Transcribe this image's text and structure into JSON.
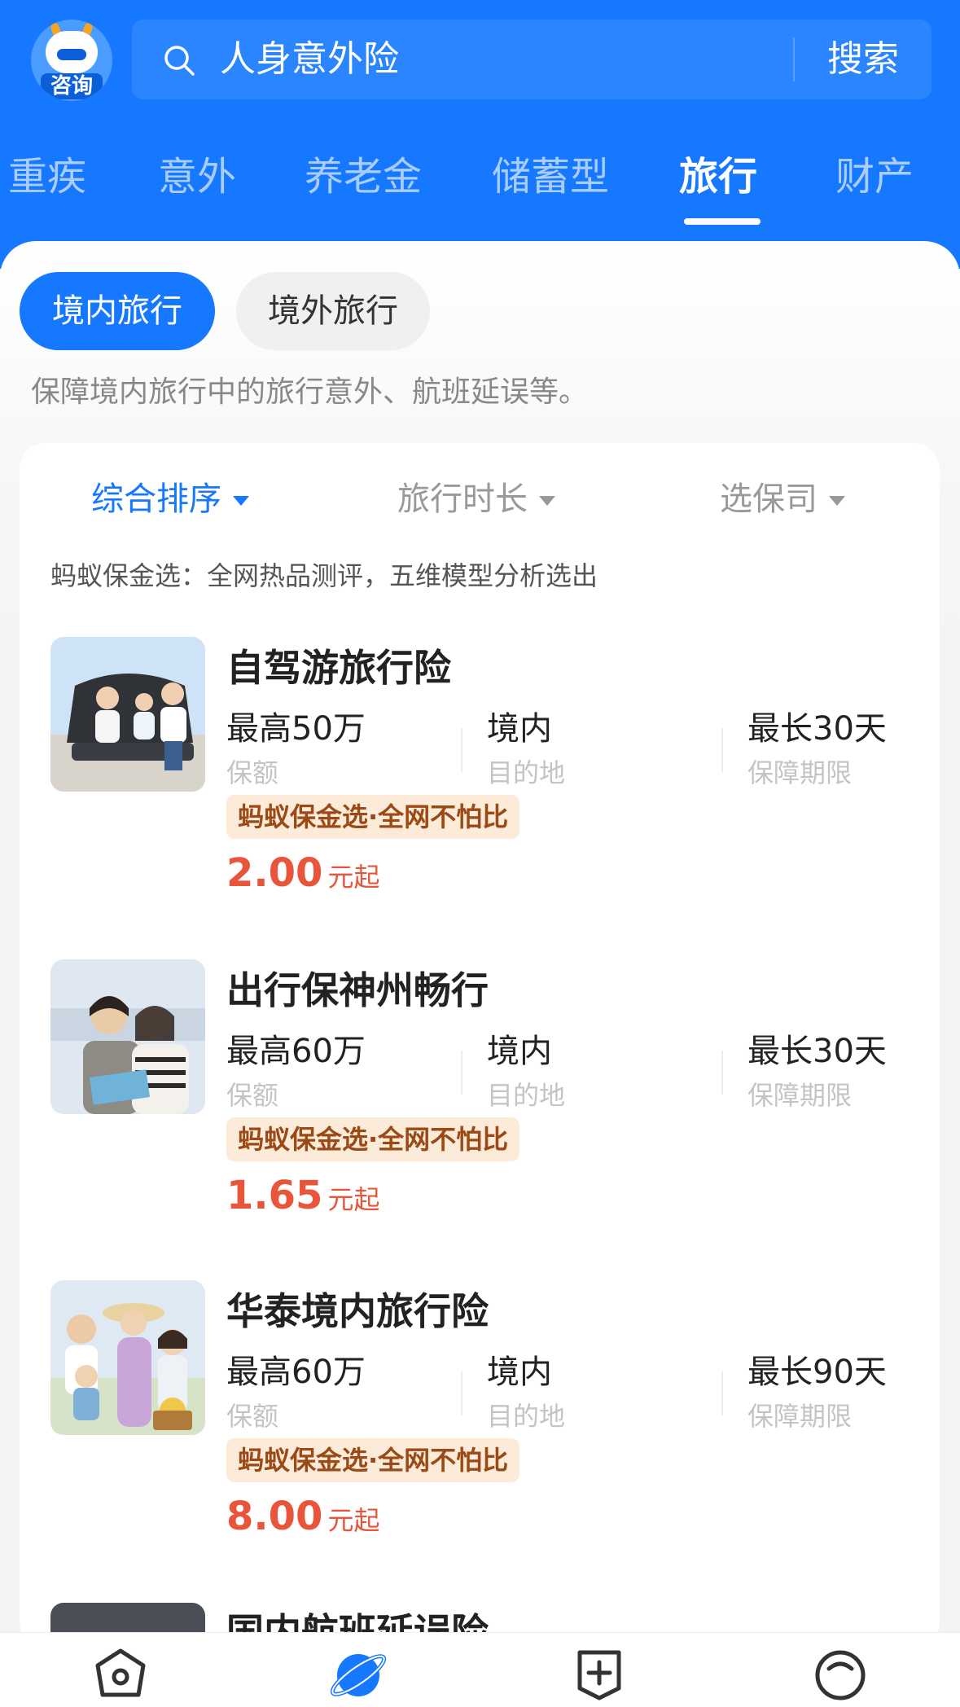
{
  "header": {
    "consult_label": "咨询",
    "search_text": "人身意外险",
    "search_button": "搜索"
  },
  "tabs": [
    {
      "label": "重疾",
      "active": false
    },
    {
      "label": "意外",
      "active": false
    },
    {
      "label": "养老金",
      "active": false
    },
    {
      "label": "储蓄型",
      "active": false
    },
    {
      "label": "旅行",
      "active": true
    },
    {
      "label": "财产",
      "active": false
    }
  ],
  "subtabs": [
    {
      "label": "境内旅行",
      "active": true
    },
    {
      "label": "境外旅行",
      "active": false
    }
  ],
  "description": "保障境内旅行中的旅行意外、航班延误等。",
  "filters": [
    {
      "label": "综合排序",
      "active": true
    },
    {
      "label": "旅行时长",
      "active": false
    },
    {
      "label": "选保司",
      "active": false
    }
  ],
  "tagline": "蚂蚁保金选：全网热品测评，五维模型分析选出",
  "products": [
    {
      "name": "自驾游旅行险",
      "coverage_value": "最高50万",
      "coverage_label": "保额",
      "destination_value": "境内",
      "destination_label": "目的地",
      "period_value": "最长30天",
      "period_label": "保障期限",
      "badge": "蚂蚁保金选·全网不怕比",
      "price": "2.00",
      "price_unit": "元起"
    },
    {
      "name": "出行保神州畅行",
      "coverage_value": "最高60万",
      "coverage_label": "保额",
      "destination_value": "境内",
      "destination_label": "目的地",
      "period_value": "最长30天",
      "period_label": "保障期限",
      "badge": "蚂蚁保金选·全网不怕比",
      "price": "1.65",
      "price_unit": "元起"
    },
    {
      "name": "华泰境内旅行险",
      "coverage_value": "最高60万",
      "coverage_label": "保额",
      "destination_value": "境内",
      "destination_label": "目的地",
      "period_value": "最长90天",
      "period_label": "保障期限",
      "badge": "蚂蚁保金选·全网不怕比",
      "price": "8.00",
      "price_unit": "元起"
    }
  ],
  "partial_product_name": "国内航班延误险",
  "colors": {
    "brand_blue": "#1677ff",
    "price_red": "#e8553a",
    "badge_bg": "#fdebd9"
  },
  "bottom_nav": [
    {
      "icon": "home-icon",
      "active": false
    },
    {
      "icon": "planet-icon",
      "active": true
    },
    {
      "icon": "add-icon",
      "active": false
    },
    {
      "icon": "profile-icon",
      "active": false
    }
  ]
}
